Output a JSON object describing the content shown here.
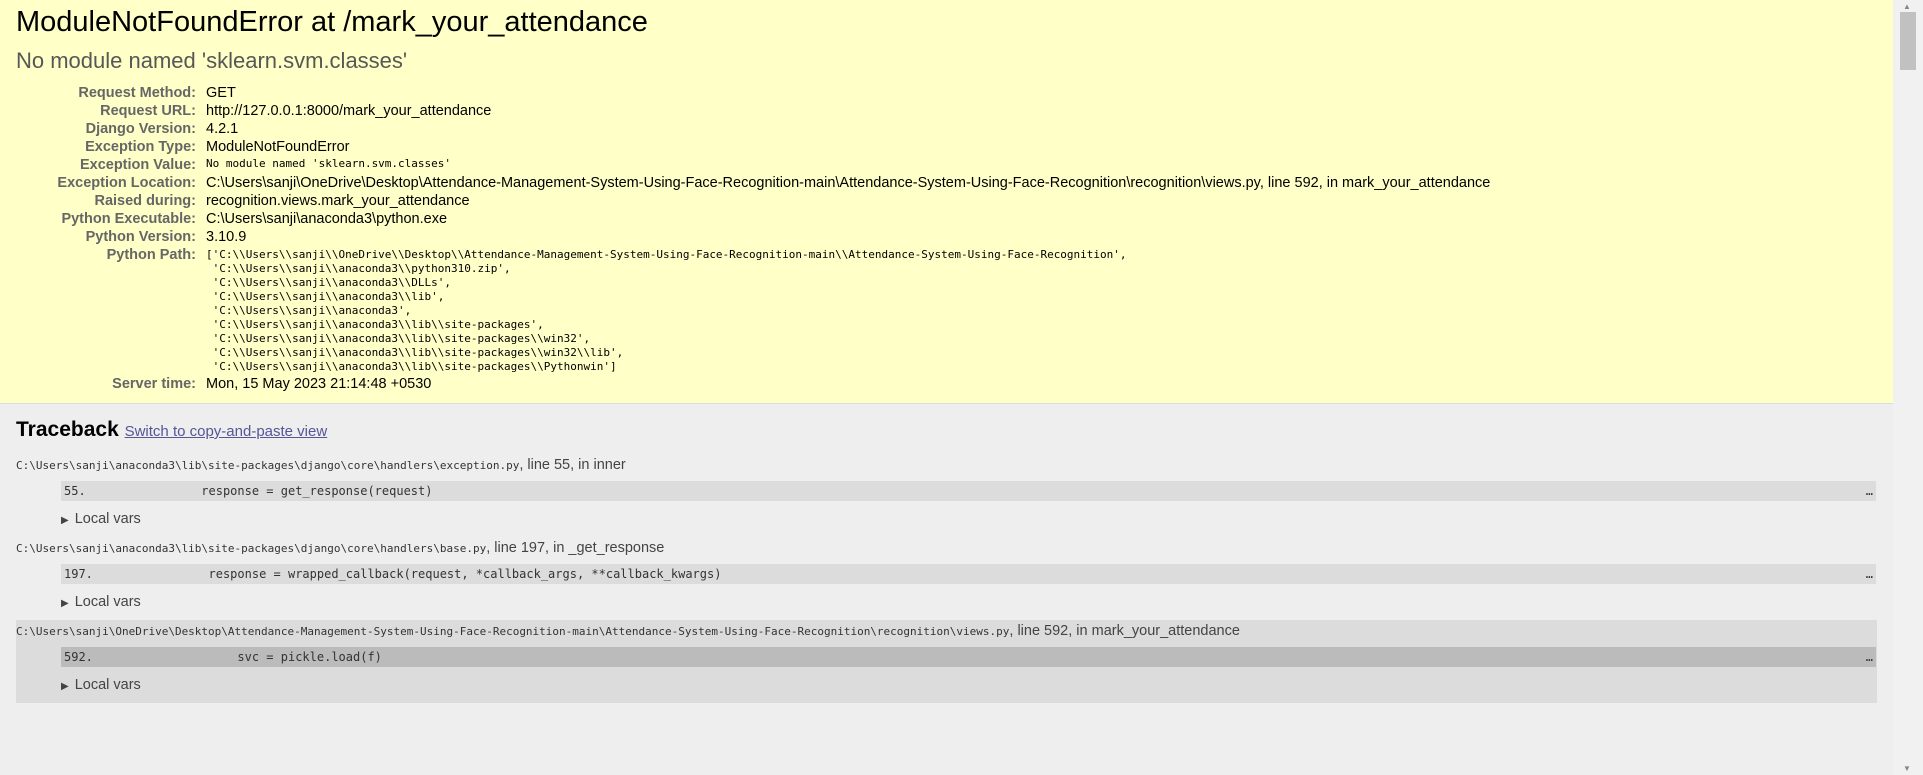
{
  "summary": {
    "title": "ModuleNotFoundError at /mark_your_attendance",
    "exception_value_heading": "No module named 'sklearn.svm.classes'",
    "meta": [
      {
        "label": "Request Method:",
        "value": "GET",
        "mono": false
      },
      {
        "label": "Request URL:",
        "value": "http://127.0.0.1:8000/mark_your_attendance",
        "mono": false
      },
      {
        "label": "Django Version:",
        "value": "4.2.1",
        "mono": false
      },
      {
        "label": "Exception Type:",
        "value": "ModuleNotFoundError",
        "mono": false
      },
      {
        "label": "Exception Value:",
        "value": "No module named 'sklearn.svm.classes'",
        "mono": true
      },
      {
        "label": "Exception Location:",
        "value": "C:\\Users\\sanji\\OneDrive\\Desktop\\Attendance-Management-System-Using-Face-Recognition-main\\Attendance-System-Using-Face-Recognition\\recognition\\views.py, line 592, in mark_your_attendance",
        "mono": false
      },
      {
        "label": "Raised during:",
        "value": "recognition.views.mark_your_attendance",
        "mono": false
      },
      {
        "label": "Python Executable:",
        "value": "C:\\Users\\sanji\\anaconda3\\python.exe",
        "mono": false
      },
      {
        "label": "Python Version:",
        "value": "3.10.9",
        "mono": false
      }
    ],
    "python_path_label": "Python Path:",
    "python_path": [
      "['C:\\\\Users\\\\sanji\\\\OneDrive\\\\Desktop\\\\Attendance-Management-System-Using-Face-Recognition-main\\\\Attendance-System-Using-Face-Recognition',",
      " 'C:\\\\Users\\\\sanji\\\\anaconda3\\\\python310.zip',",
      " 'C:\\\\Users\\\\sanji\\\\anaconda3\\\\DLLs',",
      " 'C:\\\\Users\\\\sanji\\\\anaconda3\\\\lib',",
      " 'C:\\\\Users\\\\sanji\\\\anaconda3',",
      " 'C:\\\\Users\\\\sanji\\\\anaconda3\\\\lib\\\\site-packages',",
      " 'C:\\\\Users\\\\sanji\\\\anaconda3\\\\lib\\\\site-packages\\\\win32',",
      " 'C:\\\\Users\\\\sanji\\\\anaconda3\\\\lib\\\\site-packages\\\\win32\\\\lib',",
      " 'C:\\\\Users\\\\sanji\\\\anaconda3\\\\lib\\\\site-packages\\\\Pythonwin']"
    ],
    "server_time_label": "Server time:",
    "server_time": "Mon, 15 May 2023 21:14:48 +0530"
  },
  "traceback": {
    "title": "Traceback",
    "switch_link": "Switch to copy-and-paste view",
    "local_vars_label": "Local vars",
    "frames": [
      {
        "file": "C:\\Users\\sanji\\anaconda3\\lib\\site-packages\\django\\core\\handlers\\exception.py",
        "where": ", line 55, in inner",
        "lineno": "55.",
        "code": "                response = get_response(request)",
        "ellipsis": "…",
        "user": false
      },
      {
        "file": "C:\\Users\\sanji\\anaconda3\\lib\\site-packages\\django\\core\\handlers\\base.py",
        "where": ", line 197, in _get_response",
        "lineno": "197.",
        "code": "                response = wrapped_callback(request, *callback_args, **callback_kwargs)",
        "ellipsis": "…",
        "user": false
      },
      {
        "file": "C:\\Users\\sanji\\OneDrive\\Desktop\\Attendance-Management-System-Using-Face-Recognition-main\\Attendance-System-Using-Face-Recognition\\recognition\\views.py",
        "where": ", line 592, in mark_your_attendance",
        "lineno": "592.",
        "code": "                    svc = pickle.load(f)",
        "ellipsis": "…",
        "user": true
      }
    ]
  },
  "scrollbar": {
    "up_icon": "▲",
    "down_icon": "▼"
  },
  "colors": {
    "summary_bg": "#ffffc8",
    "page_bg": "#eeeeee",
    "link": "#555599"
  }
}
